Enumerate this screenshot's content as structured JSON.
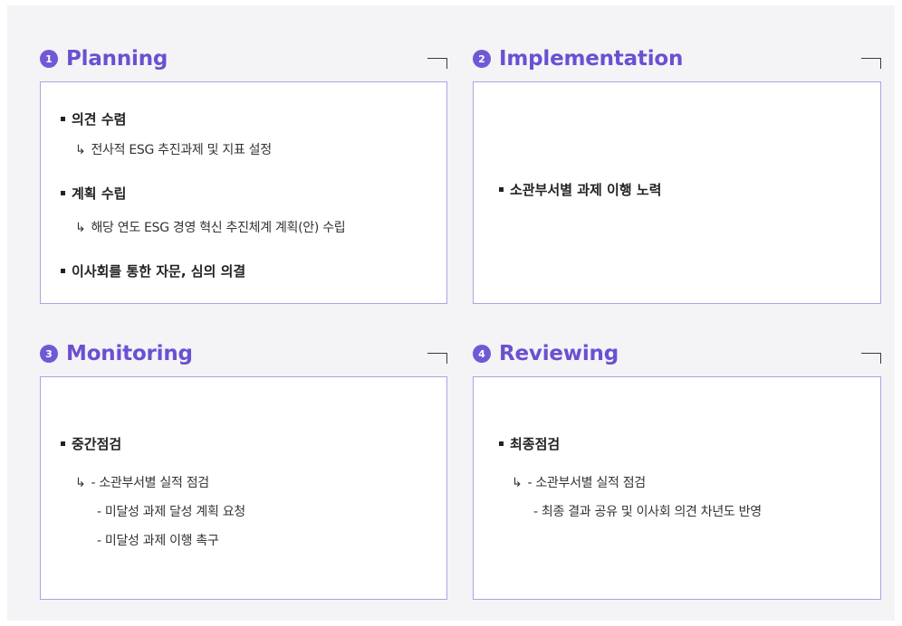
{
  "sections": {
    "planning": {
      "number": "1",
      "title": "Planning",
      "bullet1": "의견 수렴",
      "bullet1_sub": "전사적 ESG 추진과제 및 지표 설정",
      "bullet2": "계획 수립",
      "bullet2_sub": "해당 연도 ESG 경영 혁신 추진체계 계획(안) 수립",
      "bullet3": "이사회를 통한 자문, 심의 의결"
    },
    "implementation": {
      "number": "2",
      "title": "Implementation",
      "bullet1": "소관부서별 과제 이행 노력"
    },
    "monitoring": {
      "number": "3",
      "title": "Monitoring",
      "bullet1": "중간점검",
      "sub1": "- 소관부서별 실적 점검",
      "sub2": "- 미달성 과제 달성 계획 요청",
      "sub3": "- 미달성 과제 이행 촉구"
    },
    "reviewing": {
      "number": "4",
      "title": "Reviewing",
      "bullet1": "최종점검",
      "sub1": "- 소관부서별 실적 점검",
      "sub2": "- 최종 결과 공유 및 이사회 의견 차년도 반영"
    }
  },
  "glyphs": {
    "arrow": "↳"
  },
  "colors": {
    "accent": "#6b50d2",
    "box_border": "#aaa4e0",
    "panel_bg": "#f4f4f6"
  }
}
